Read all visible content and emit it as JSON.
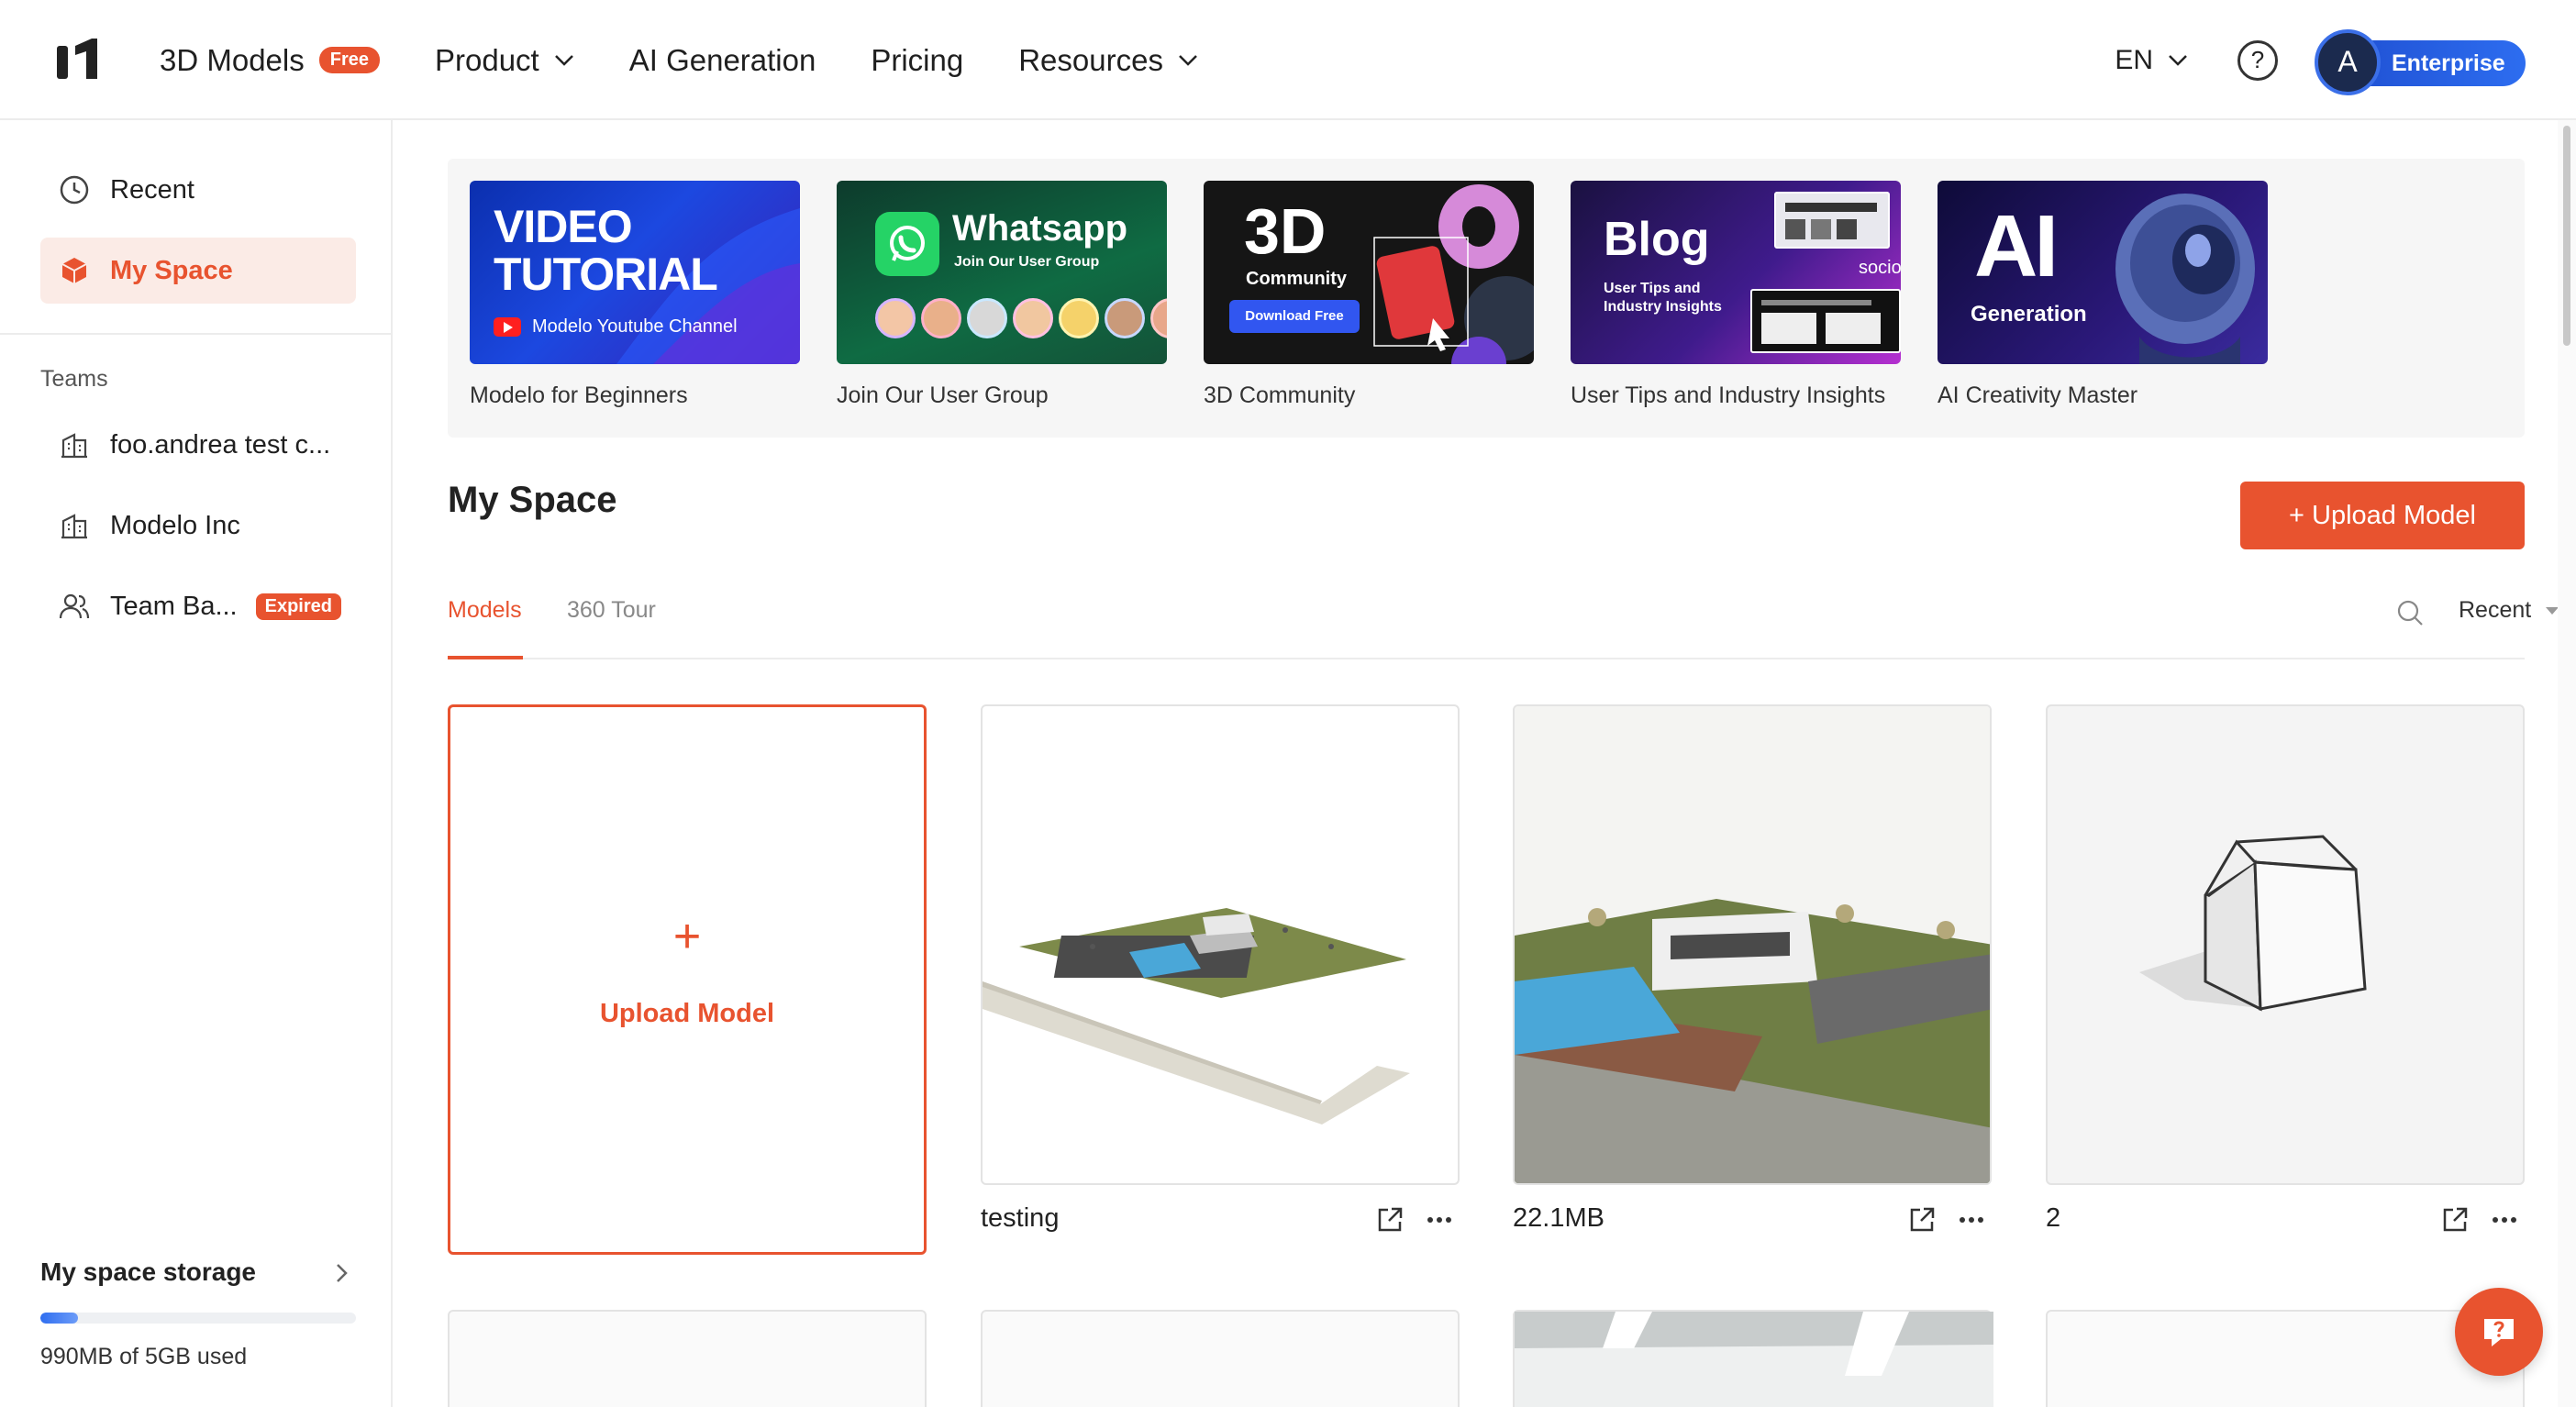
{
  "nav": {
    "brand_badge": "Free",
    "items": [
      {
        "label": "3D Models",
        "has_dropdown": false
      },
      {
        "label": "Product",
        "has_dropdown": true
      },
      {
        "label": "AI Generation",
        "has_dropdown": false
      },
      {
        "label": "Pricing",
        "has_dropdown": false
      },
      {
        "label": "Resources",
        "has_dropdown": true
      }
    ],
    "language": "EN",
    "help_icon": "question-circle-icon",
    "avatar_initial": "A",
    "plan_label": "Enterprise"
  },
  "sidebar": {
    "items": [
      {
        "label": "Recent",
        "icon": "clock-icon"
      },
      {
        "label": "My Space",
        "icon": "cube-icon",
        "active": true
      }
    ],
    "teams_heading": "Teams",
    "teams": [
      {
        "label": "foo.andrea test c...",
        "icon": "building-icon"
      },
      {
        "label": "Modelo Inc",
        "icon": "building-icon"
      },
      {
        "label": "Team Ba...",
        "icon": "users-icon",
        "badge": "Expired"
      }
    ],
    "storage": {
      "title": "My space storage",
      "used_text": "990MB of 5GB used",
      "fraction_used": 0.12
    }
  },
  "banners": [
    {
      "caption": "Modelo for Beginners",
      "thumb_lines": [
        "VIDEO",
        "TUTORIAL"
      ],
      "thumb_sub": "Modelo Youtube Channel"
    },
    {
      "caption": "Join Our User Group",
      "thumb_title": "Whatsapp",
      "thumb_sub": "Join Our User Group"
    },
    {
      "caption": "3D Community",
      "thumb_title": "3D",
      "thumb_sub": "Community",
      "thumb_button": "Download Free"
    },
    {
      "caption": "User Tips and Industry Insights",
      "thumb_title": "Blog",
      "thumb_sub_lines": [
        "User Tips and",
        "Industry Insights"
      ],
      "thumb_brand": "socio"
    },
    {
      "caption": "AI Creativity Master",
      "thumb_title": "AI",
      "thumb_sub": "Generation"
    }
  ],
  "main": {
    "title": "My Space",
    "upload_button": "+ Upload Model",
    "tabs": [
      {
        "label": "Models",
        "active": true
      },
      {
        "label": "360 Tour",
        "active": false
      }
    ],
    "sort_label": "Recent",
    "upload_card_label": "Upload Model",
    "models": [
      {
        "name": "testing",
        "thumb": "site-plan-render"
      },
      {
        "name": "22.1MB",
        "thumb": "villa-pool-render"
      },
      {
        "name": "2",
        "thumb": "house-placeholder-icon"
      }
    ]
  },
  "colors": {
    "accent": "#e8532f",
    "enterprise_blue": "#2d6df0",
    "active_bg": "#fbebe6"
  }
}
